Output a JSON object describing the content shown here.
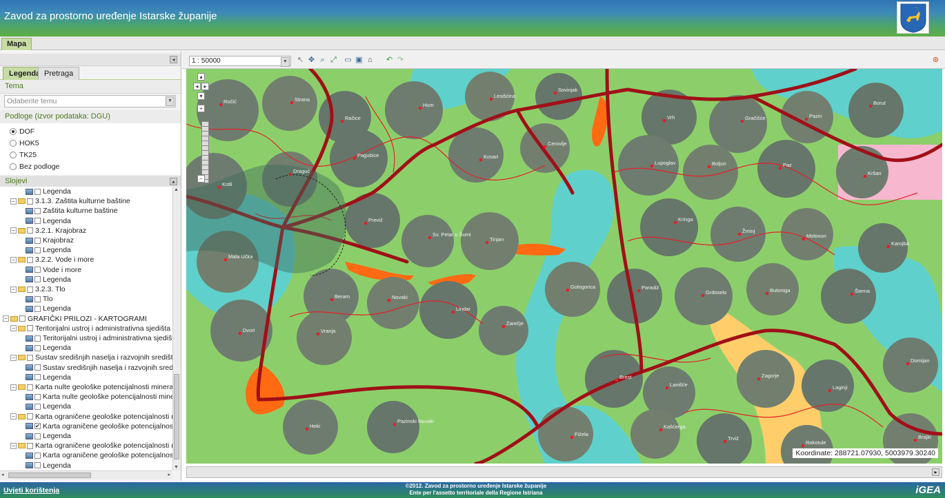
{
  "header": {
    "title": "Zavod za prostorno uređenje Istarske županije",
    "crest_icon": "goat-crest-icon"
  },
  "tabs": {
    "main": "Mapa"
  },
  "sidebar": {
    "tabs": [
      "Legenda",
      "Pretraga"
    ],
    "tema_label": "Tema",
    "tema_placeholder": "Odaberite temu",
    "podloge_label": "Podloge (izvor podataka: DGU)",
    "podloge": [
      {
        "label": "DOF",
        "selected": true
      },
      {
        "label": "HOK5",
        "selected": false
      },
      {
        "label": "TK25",
        "selected": false
      },
      {
        "label": "Bez podloge",
        "selected": false
      }
    ],
    "slojevi_label": "Slojevi",
    "tree": [
      {
        "label": "Legenda",
        "indent": 3,
        "kind": "layer",
        "checked": false
      },
      {
        "label": "3.1.3. Zaštita kulturne baštine",
        "indent": 1,
        "kind": "folder"
      },
      {
        "label": "Zaštita kulturne baštine",
        "indent": 3,
        "kind": "layer",
        "checked": false
      },
      {
        "label": "Legenda",
        "indent": 3,
        "kind": "layer",
        "checked": false
      },
      {
        "label": "3.2.1. Krajobraz",
        "indent": 1,
        "kind": "folder"
      },
      {
        "label": "Krajobraz",
        "indent": 3,
        "kind": "layer",
        "checked": false
      },
      {
        "label": "Legenda",
        "indent": 3,
        "kind": "layer",
        "checked": false
      },
      {
        "label": "3.2.2. Vode i more",
        "indent": 1,
        "kind": "folder"
      },
      {
        "label": "Vode i more",
        "indent": 3,
        "kind": "layer",
        "checked": false
      },
      {
        "label": "Legenda",
        "indent": 3,
        "kind": "layer",
        "checked": false
      },
      {
        "label": "3.2.3. Tlo",
        "indent": 1,
        "kind": "folder"
      },
      {
        "label": "Tlo",
        "indent": 3,
        "kind": "layer",
        "checked": false
      },
      {
        "label": "Legenda",
        "indent": 3,
        "kind": "layer",
        "checked": false
      },
      {
        "label": "GRAFIČKI PRILOZI - KARTOGRAMI",
        "indent": 0,
        "kind": "folder"
      },
      {
        "label": "Teritorijalni ustroj i administrativna sjedišta",
        "indent": 1,
        "kind": "folder"
      },
      {
        "label": "Teritorijalni ustroj i administrativna sjedišta",
        "indent": 3,
        "kind": "layer",
        "checked": false
      },
      {
        "label": "Legenda",
        "indent": 3,
        "kind": "layer",
        "checked": false
      },
      {
        "label": "Sustav središnjih naselja i razvojnih središta",
        "indent": 1,
        "kind": "folder"
      },
      {
        "label": "Sustav središnjih naselja i razvojnih središta",
        "indent": 3,
        "kind": "layer",
        "checked": false
      },
      {
        "label": "Legenda",
        "indent": 3,
        "kind": "layer",
        "checked": false
      },
      {
        "label": "Karta nulte geološke potencijalnosti mineralnih sir",
        "indent": 1,
        "kind": "folder"
      },
      {
        "label": "Karta nulte geološke potencijalnosti mineralnih",
        "indent": 3,
        "kind": "layer",
        "checked": false
      },
      {
        "label": "Legenda",
        "indent": 3,
        "kind": "layer",
        "checked": false
      },
      {
        "label": "Karta ograničene geološke potencijalnosti minera",
        "indent": 1,
        "kind": "folder"
      },
      {
        "label": "Karta ograničene geološke potencijalnosti mine",
        "indent": 3,
        "kind": "layer",
        "checked": true
      },
      {
        "label": "Legenda",
        "indent": 3,
        "kind": "layer",
        "checked": false
      },
      {
        "label": "Karta ograničene geološke potencijalnosti minera",
        "indent": 1,
        "kind": "folder"
      },
      {
        "label": "Karta ograničene geološke potencijalnosti mine",
        "indent": 3,
        "kind": "layer",
        "checked": false
      },
      {
        "label": "Legenda",
        "indent": 3,
        "kind": "layer",
        "checked": false
      }
    ]
  },
  "map": {
    "scale": "1 : 50000",
    "coordinates_label": "Koordinate:",
    "coordinates_value": "288721.07930, 5003979.30240",
    "places": [
      "Ročić",
      "Strana",
      "Račice",
      "Hum",
      "Lesišćina",
      "Sovinjak",
      "Kotli",
      "Draguć",
      "Pagubice",
      "Kosari",
      "Cerovlje",
      "Vrh",
      "Gračišće",
      "Pazin",
      "Borut",
      "Lupoglav",
      "Boljun",
      "Paz",
      "Kršan",
      "Mala Učka",
      "Previž",
      "Sv. Petar u Šumi",
      "Tinjan",
      "Kringa",
      "Žminj",
      "Motovun",
      "Karojba",
      "Beram",
      "Novaki",
      "Lindar",
      "Zarečje",
      "Gologorica",
      "Paradiž",
      "Grdoselo",
      "Butoniga",
      "Šterna",
      "Dvori",
      "Vranja",
      "Brest",
      "Lanišće",
      "Zagorje",
      "Laginji",
      "Domijan",
      "Fižela",
      "Pazinski Novaki",
      "Heki",
      "Kašćerga",
      "Trviž",
      "Rakotule",
      "Brajki"
    ],
    "colors": {
      "green": "#8ccf6a",
      "aqua": "#5fd0cc",
      "orange": "#ff6a12",
      "pink": "#f7b8cf",
      "beige": "#ffce6a",
      "road": "#a01018",
      "boundary": "#e41f27"
    }
  },
  "footer": {
    "terms_link": "Uvjeti korištenja",
    "copyright_line1": "©2012. Zavod za prostorno uređenje Istarske županije",
    "copyright_line2": "Ente per l'assetto territoriale della Regione Istriana",
    "brand": "iGEA"
  }
}
